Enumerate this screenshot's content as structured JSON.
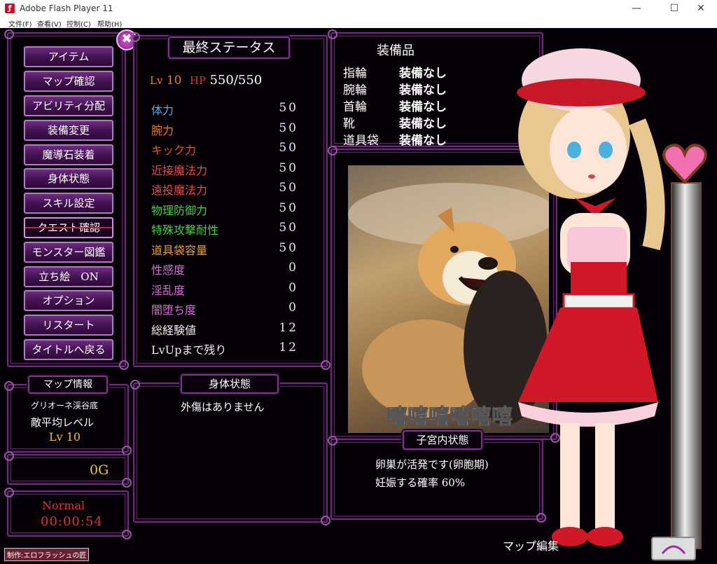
{
  "window": {
    "title": "Adobe Flash Player 11",
    "menus": [
      "文件(F)",
      "查看(V)",
      "控制(C)",
      "帮助(H)"
    ],
    "buttons": {
      "minimize": "—",
      "maximize": "☐",
      "close": "✕"
    }
  },
  "menu": {
    "items": [
      "アイテム",
      "マップ確認",
      "アビリティ分配",
      "装備変更",
      "魔導石装着",
      "身体状態",
      "スキル設定",
      "クエスト確認",
      "モンスター図鑑",
      "立ち絵　ON",
      "オプション",
      "リスタート",
      "タイトルへ戻る"
    ],
    "close_glyph": "✖"
  },
  "status": {
    "header": "最終ステータス",
    "lv_label": "Lv",
    "lv_value": "10",
    "hp_label": "HP",
    "hp_value": "550/550",
    "rows": [
      {
        "label": "体力",
        "value": "50",
        "color": "#5aa8f0"
      },
      {
        "label": "腕力",
        "value": "50",
        "color": "#f07a28"
      },
      {
        "label": "キック力",
        "value": "50",
        "color": "#e05a2a"
      },
      {
        "label": "近接魔法力",
        "value": "50",
        "color": "#f04848"
      },
      {
        "label": "遠投魔法力",
        "value": "50",
        "color": "#f04848"
      },
      {
        "label": "物理防御力",
        "value": "50",
        "color": "#48d048"
      },
      {
        "label": "特殊攻撃耐性",
        "value": "50",
        "color": "#48d048"
      },
      {
        "label": "道具袋容量",
        "value": "50",
        "color": "#e8a030"
      },
      {
        "label": "性感度",
        "value": "0",
        "color": "#d070d0"
      },
      {
        "label": "淫乱度",
        "value": "0",
        "color": "#d070d0"
      },
      {
        "label": "闇堕ち度",
        "value": "0",
        "color": "#d070d0"
      },
      {
        "label": "総経験値",
        "value": "12",
        "color": "#f0f0f0"
      },
      {
        "label": "LvUpまで残り",
        "value": "12",
        "color": "#f0f0f0"
      }
    ]
  },
  "equipment": {
    "header": "装備品",
    "rows": [
      {
        "slot": "指輪",
        "value": "装備なし"
      },
      {
        "slot": "腕輪",
        "value": "装備なし"
      },
      {
        "slot": "首輪",
        "value": "装備なし"
      },
      {
        "slot": "靴",
        "value": "装備なし"
      },
      {
        "slot": "道具袋",
        "value": "装備なし"
      }
    ]
  },
  "meme": {
    "caption": "嘻嘻嘻嘻嘻嘻"
  },
  "uterus": {
    "header": "子宮内状態",
    "line1": "卵巣が活発です(卵胞期)",
    "line2": "妊娠する確率 60%"
  },
  "body_state": {
    "header": "身体状態",
    "text": "外傷はありません"
  },
  "map_info": {
    "header": "マップ情報",
    "location": "グリオーネ渓谷底",
    "level_label": "敵平均レベル",
    "level_value": "Lv 10"
  },
  "gold": {
    "value": "0G"
  },
  "time": {
    "difficulty": "Normal",
    "clock": "00:00:54"
  },
  "footer": {
    "map_edit": "マップ編集",
    "credit": "制作:エロフラッシュの匠"
  }
}
